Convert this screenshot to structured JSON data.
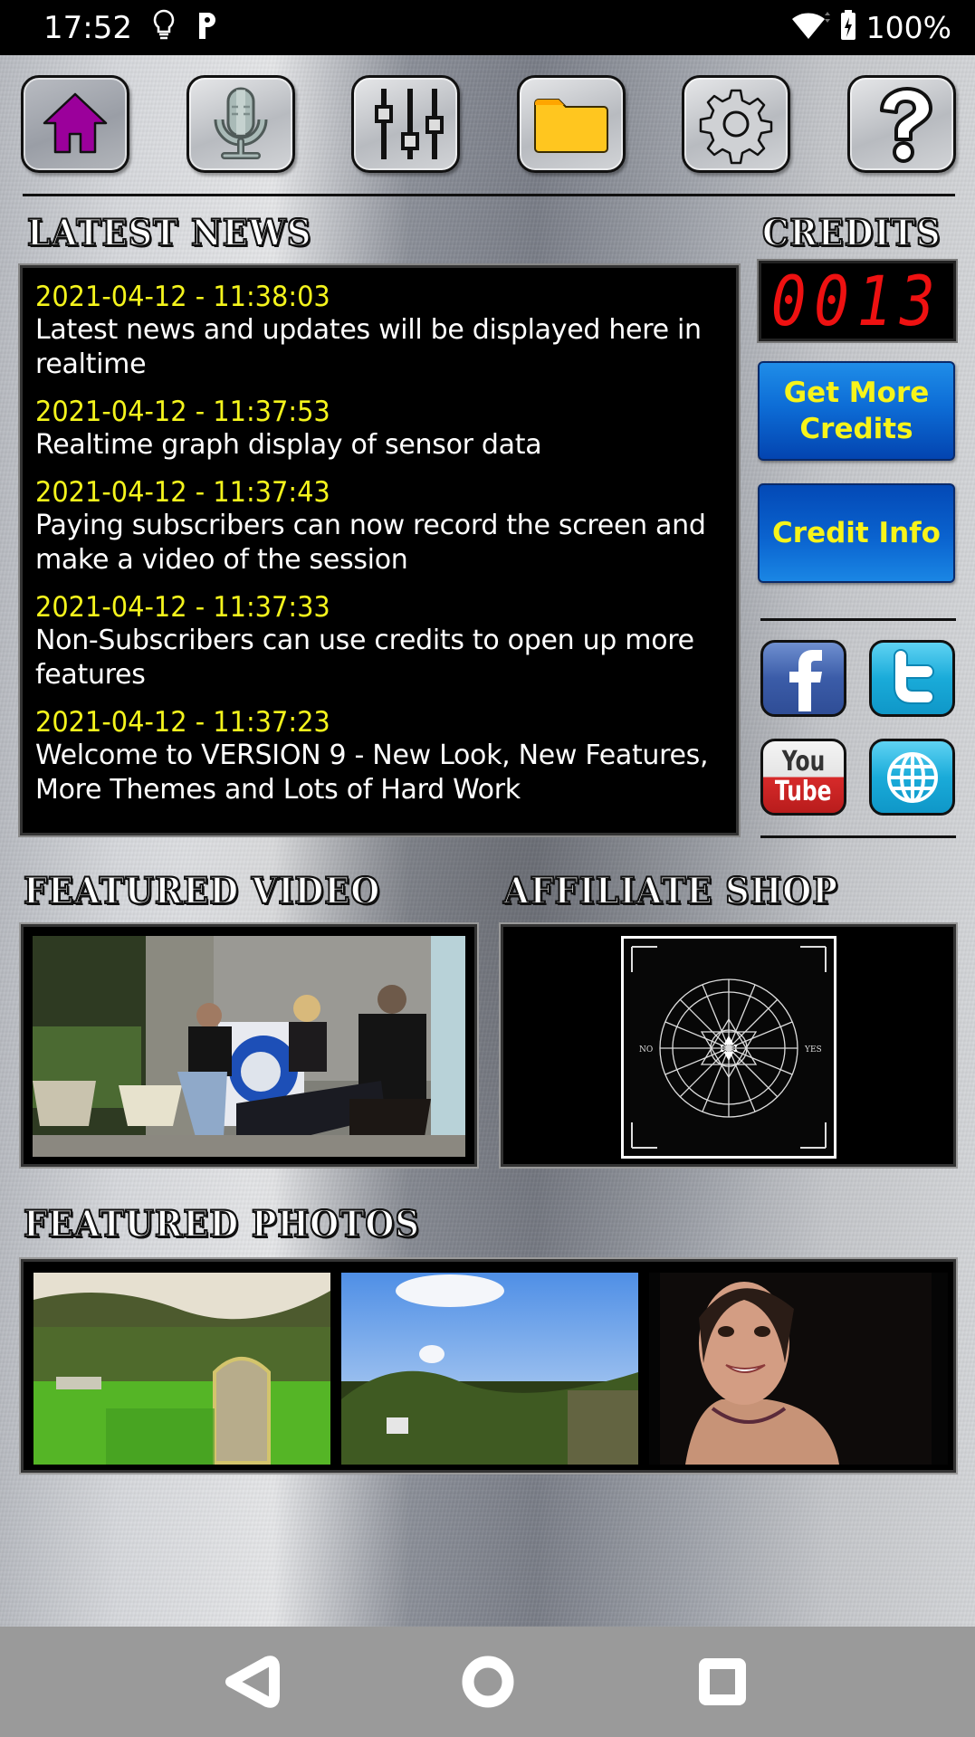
{
  "status_bar": {
    "time": "17:52",
    "notification_icons": [
      "lightbulb-icon",
      "parking-p-icon"
    ],
    "battery_percent": "100%",
    "system_icons": [
      "wifi-icon",
      "battery-charging-icon"
    ]
  },
  "toolbar": {
    "buttons": [
      {
        "name": "home",
        "icon": "home-icon",
        "active": true,
        "color": "#9b009b"
      },
      {
        "name": "record",
        "icon": "microphone-icon",
        "active": false
      },
      {
        "name": "controls",
        "icon": "sliders-icon",
        "active": false
      },
      {
        "name": "files",
        "icon": "folder-icon",
        "active": false,
        "color": "#ffc61f"
      },
      {
        "name": "settings",
        "icon": "gear-icon",
        "active": false
      },
      {
        "name": "help",
        "icon": "question-icon",
        "active": false
      }
    ]
  },
  "news": {
    "title": "LATEST NEWS",
    "items": [
      {
        "date": "2021-04-12 - 11:38:03",
        "text": "Latest news and updates will be displayed here in realtime"
      },
      {
        "date": "2021-04-12 - 11:37:53",
        "text": "Realtime graph display of sensor data"
      },
      {
        "date": "2021-04-12 - 11:37:43",
        "text": "Paying subscribers can now record the screen and make a video of the session"
      },
      {
        "date": "2021-04-12 - 11:37:33",
        "text": "Non-Subscribers can use credits to open up more features"
      },
      {
        "date": "2021-04-12 - 11:37:23",
        "text": "Welcome to VERSION 9 - New Look, New Features, More Themes and Lots of Hard Work"
      }
    ],
    "date_color": "#f4f41c"
  },
  "credits": {
    "title": "CREDITS",
    "value": "0013",
    "display_color": "#ee1111",
    "get_more_label": "Get More Credits",
    "info_label": "Credit Info"
  },
  "social": {
    "facebook": {
      "letter": "f"
    },
    "twitter": {
      "letter": "t"
    },
    "youtube": {
      "top": "You",
      "bottom": "Tube"
    },
    "website": {
      "icon": "globe-icon"
    }
  },
  "featured_video": {
    "title": "FEATURED VIDEO",
    "thumbnail": "three people sitting on a bench outside a stone building"
  },
  "affiliate_shop": {
    "title": "AFFILIATE SHOP",
    "thumbnail": "black spirit board cloth with alphabet circle and star",
    "board_labels": {
      "left": "NO",
      "right": "YES"
    }
  },
  "featured_photos": {
    "title": "FEATURED PHOTOS",
    "photos": [
      {
        "subject": "gravestone in green grass"
      },
      {
        "subject": "sky with hedge and van"
      },
      {
        "subject": "smiling woman with necklace"
      }
    ]
  },
  "nav_bar": {
    "buttons": [
      "back",
      "home",
      "recents"
    ]
  }
}
